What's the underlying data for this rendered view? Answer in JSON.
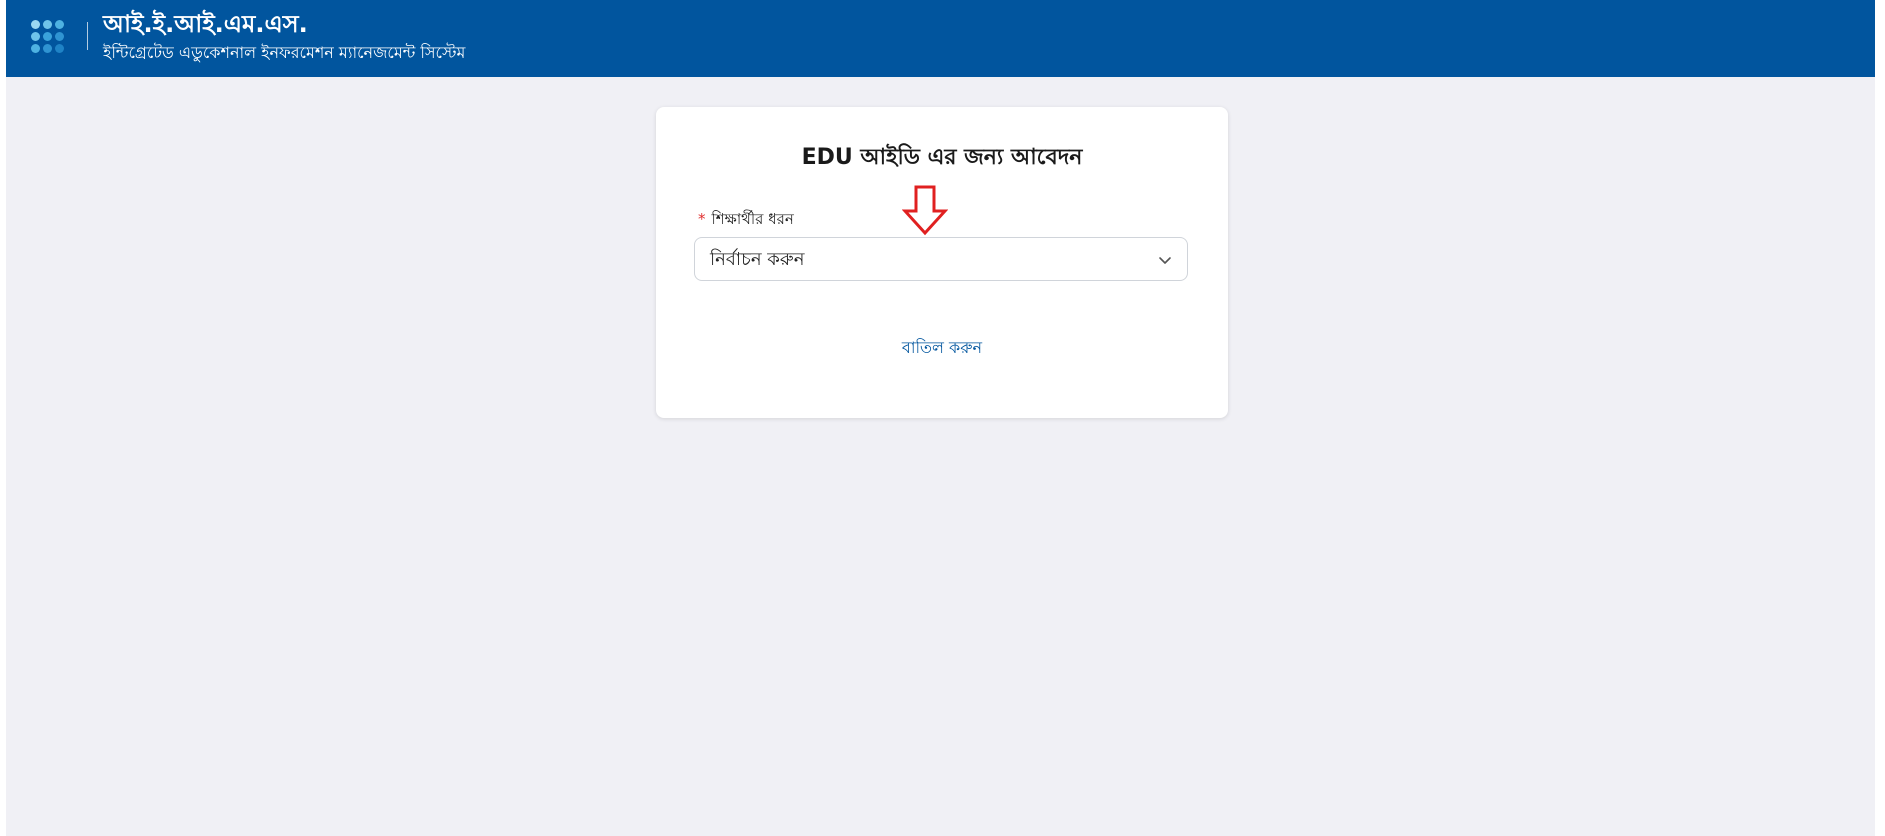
{
  "header": {
    "brand_title": "আই.ই.আই.এম.এস.",
    "brand_subtitle": "ইন্টিগ্রেটেড এডুকেশনাল ইনফরমেশন ম্যানেজমেন্ট সিস্টেম",
    "logo_icon": "dot-grid-logo-icon",
    "background_color": "#01559e"
  },
  "card": {
    "title": "EDU আইডি এর জন্য আবেদন",
    "pointer_icon": "down-arrow-outline-icon",
    "pointer_color": "#e02020",
    "field": {
      "required_marker": "*",
      "label": "শিক্ষার্থীর ধরন",
      "selected_value": "নির্বাচন করুন",
      "dropdown_icon": "chevron-down-icon"
    },
    "cancel_label": "বাতিল করুন",
    "link_color": "#01559e"
  },
  "page": {
    "background_color": "#f0f0f5"
  }
}
